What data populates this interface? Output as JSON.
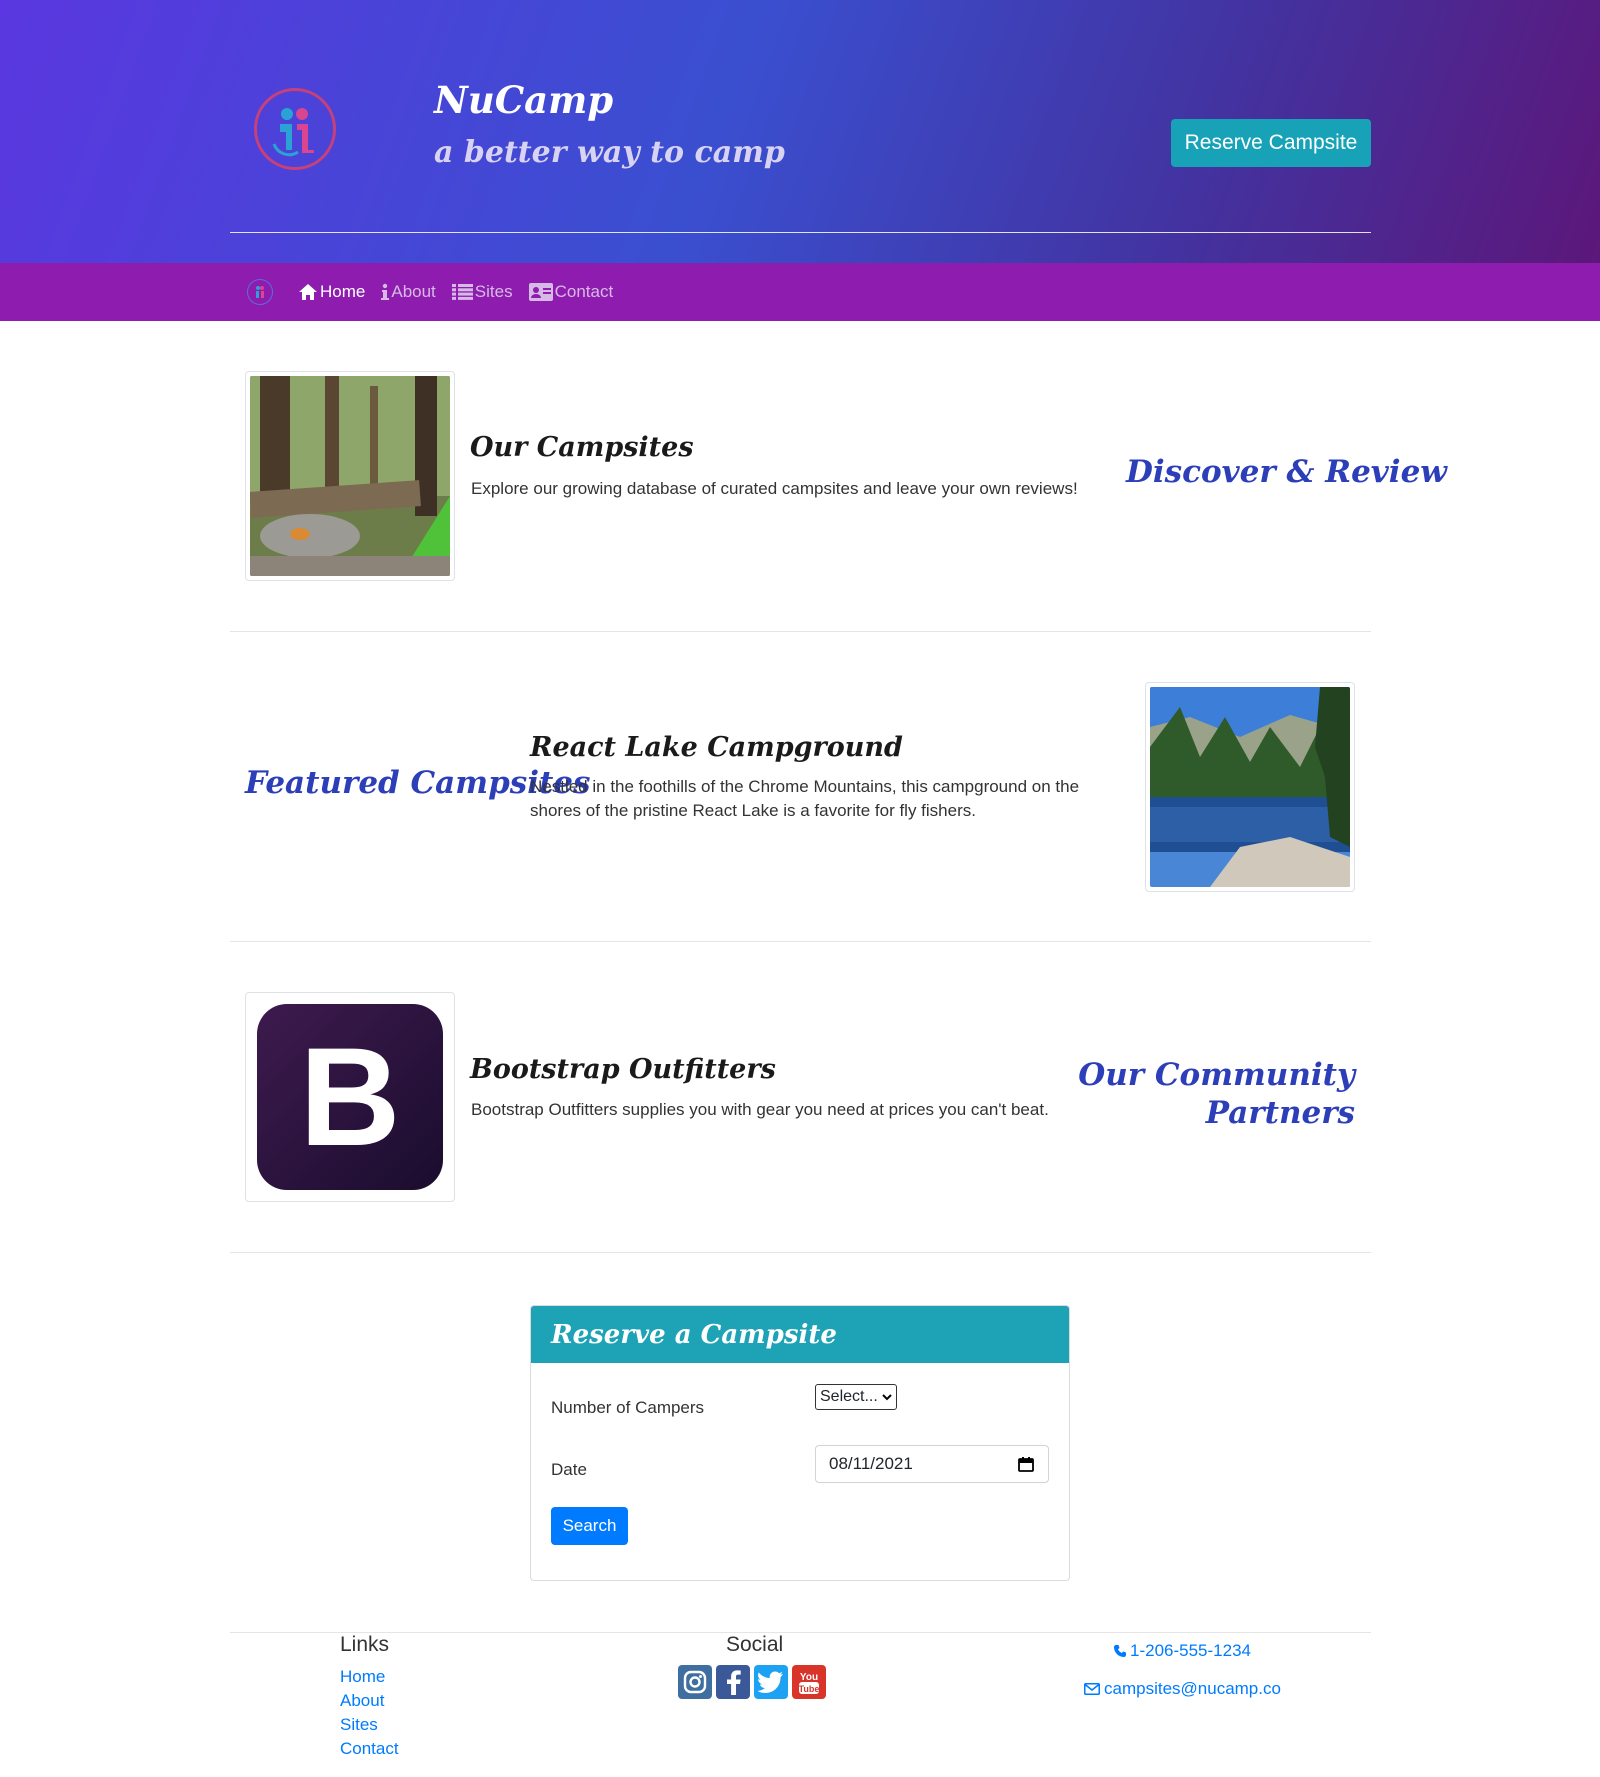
{
  "header": {
    "brand_title": "NuCamp",
    "brand_tagline": "a better way to camp",
    "reserve_button": "Reserve Campsite",
    "gradient_colors": [
      "#5a37e0",
      "#3a4fd0",
      "#5c177a"
    ]
  },
  "navbar": {
    "background": "#8e1daf",
    "items": [
      {
        "label": "Home",
        "icon": "home-icon",
        "active": true
      },
      {
        "label": "About",
        "icon": "info-icon",
        "active": false
      },
      {
        "label": "Sites",
        "icon": "list-icon",
        "active": false
      },
      {
        "label": "Contact",
        "icon": "address-card-icon",
        "active": false
      }
    ]
  },
  "sections": [
    {
      "side_heading": "Discover & Review",
      "title": "Our Campsites",
      "text": "Explore our growing database of curated campsites and leave your own reviews!"
    },
    {
      "side_heading": "Featured Campsites",
      "title": "React Lake Campground",
      "text_line1": "Nestled in the foothills of the Chrome Mountains, this campground on the",
      "text_line2": "shores of the pristine React Lake is a favorite for fly fishers."
    },
    {
      "side_heading_line1": "Our Community",
      "side_heading_line2": "Partners",
      "title": "Bootstrap Outfitters",
      "text": "Bootstrap Outfitters supplies you with gear you need at prices you can't beat.",
      "logo_letter": "B"
    }
  ],
  "reserve_form": {
    "title": "Reserve a Campsite",
    "campers_label": "Number of Campers",
    "campers_value": "Select...",
    "date_label": "Date",
    "date_value": "08/11/2021",
    "search_button": "Search"
  },
  "footer": {
    "links_heading": "Links",
    "links": [
      "Home",
      "About",
      "Sites",
      "Contact"
    ],
    "social_heading": "Social",
    "social_icons": [
      "instagram-icon",
      "facebook-icon",
      "twitter-icon",
      "youtube-icon"
    ],
    "phone": "1-206-555-1234",
    "email": "campsites@nucamp.co"
  }
}
